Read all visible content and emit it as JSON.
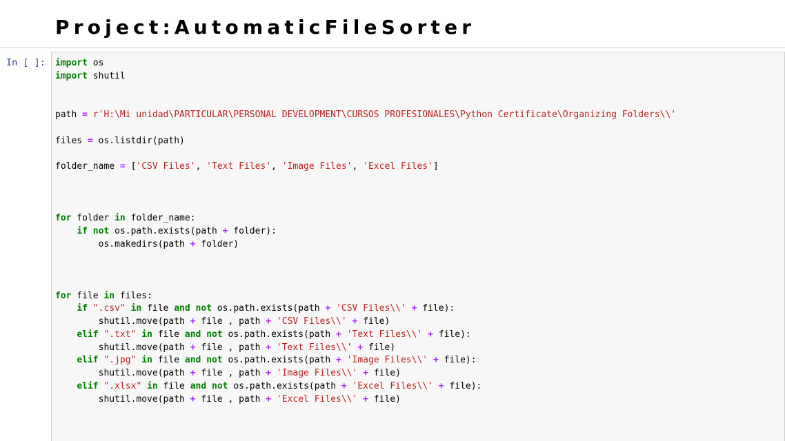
{
  "markdown_cell": {
    "title": "Project:AutomaticFileSorter"
  },
  "code_cell": {
    "prompt": "In [ ]:",
    "lines": [
      [
        [
          "kw",
          "import"
        ],
        [
          "txt",
          " os"
        ]
      ],
      [
        [
          "kw",
          "import"
        ],
        [
          "txt",
          " shutil"
        ]
      ],
      [],
      [],
      [
        [
          "txt",
          "path "
        ],
        [
          "op",
          "="
        ],
        [
          "txt",
          " "
        ],
        [
          "str",
          "r'H:\\Mi unidad\\PARTICULAR\\PERSONAL DEVELOPMENT\\CURSOS PROFESIONALES\\Python Certificate\\Organizing Folders\\\\'"
        ]
      ],
      [],
      [
        [
          "txt",
          "files "
        ],
        [
          "op",
          "="
        ],
        [
          "txt",
          " os.listdir(path)"
        ]
      ],
      [],
      [
        [
          "txt",
          "folder_name "
        ],
        [
          "op",
          "="
        ],
        [
          "txt",
          " ["
        ],
        [
          "str",
          "'CSV Files'"
        ],
        [
          "txt",
          ", "
        ],
        [
          "str",
          "'Text Files'"
        ],
        [
          "txt",
          ", "
        ],
        [
          "str",
          "'Image Files'"
        ],
        [
          "txt",
          ", "
        ],
        [
          "str",
          "'Excel Files'"
        ],
        [
          "txt",
          "]"
        ]
      ],
      [],
      [],
      [],
      [
        [
          "kw",
          "for"
        ],
        [
          "txt",
          " folder "
        ],
        [
          "kw",
          "in"
        ],
        [
          "txt",
          " folder_name:"
        ]
      ],
      [
        [
          "txt",
          "    "
        ],
        [
          "kw",
          "if"
        ],
        [
          "txt",
          " "
        ],
        [
          "kw",
          "not"
        ],
        [
          "txt",
          " os.path.exists(path "
        ],
        [
          "op",
          "+"
        ],
        [
          "txt",
          " folder):"
        ]
      ],
      [
        [
          "txt",
          "        os.makedirs(path "
        ],
        [
          "op",
          "+"
        ],
        [
          "txt",
          " folder)"
        ]
      ],
      [],
      [],
      [],
      [
        [
          "kw",
          "for"
        ],
        [
          "txt",
          " file "
        ],
        [
          "kw",
          "in"
        ],
        [
          "txt",
          " files:"
        ]
      ],
      [
        [
          "txt",
          "    "
        ],
        [
          "kw",
          "if"
        ],
        [
          "txt",
          " "
        ],
        [
          "str",
          "\".csv\""
        ],
        [
          "txt",
          " "
        ],
        [
          "kw",
          "in"
        ],
        [
          "txt",
          " file "
        ],
        [
          "kw",
          "and"
        ],
        [
          "txt",
          " "
        ],
        [
          "kw",
          "not"
        ],
        [
          "txt",
          " os.path.exists(path "
        ],
        [
          "op",
          "+"
        ],
        [
          "txt",
          " "
        ],
        [
          "str",
          "'CSV Files\\\\'"
        ],
        [
          "txt",
          " "
        ],
        [
          "op",
          "+"
        ],
        [
          "txt",
          " file):"
        ]
      ],
      [
        [
          "txt",
          "        shutil.move(path "
        ],
        [
          "op",
          "+"
        ],
        [
          "txt",
          " file , path "
        ],
        [
          "op",
          "+"
        ],
        [
          "txt",
          " "
        ],
        [
          "str",
          "'CSV Files\\\\'"
        ],
        [
          "txt",
          " "
        ],
        [
          "op",
          "+"
        ],
        [
          "txt",
          " file)"
        ]
      ],
      [
        [
          "txt",
          "    "
        ],
        [
          "kw",
          "elif"
        ],
        [
          "txt",
          " "
        ],
        [
          "str",
          "\".txt\""
        ],
        [
          "txt",
          " "
        ],
        [
          "kw",
          "in"
        ],
        [
          "txt",
          " file "
        ],
        [
          "kw",
          "and"
        ],
        [
          "txt",
          " "
        ],
        [
          "kw",
          "not"
        ],
        [
          "txt",
          " os.path.exists(path "
        ],
        [
          "op",
          "+"
        ],
        [
          "txt",
          " "
        ],
        [
          "str",
          "'Text Files\\\\'"
        ],
        [
          "txt",
          " "
        ],
        [
          "op",
          "+"
        ],
        [
          "txt",
          " file):"
        ]
      ],
      [
        [
          "txt",
          "        shutil.move(path "
        ],
        [
          "op",
          "+"
        ],
        [
          "txt",
          " file , path "
        ],
        [
          "op",
          "+"
        ],
        [
          "txt",
          " "
        ],
        [
          "str",
          "'Text Files\\\\'"
        ],
        [
          "txt",
          " "
        ],
        [
          "op",
          "+"
        ],
        [
          "txt",
          " file)"
        ]
      ],
      [
        [
          "txt",
          "    "
        ],
        [
          "kw",
          "elif"
        ],
        [
          "txt",
          " "
        ],
        [
          "str",
          "\".jpg\""
        ],
        [
          "txt",
          " "
        ],
        [
          "kw",
          "in"
        ],
        [
          "txt",
          " file "
        ],
        [
          "kw",
          "and"
        ],
        [
          "txt",
          " "
        ],
        [
          "kw",
          "not"
        ],
        [
          "txt",
          " os.path.exists(path "
        ],
        [
          "op",
          "+"
        ],
        [
          "txt",
          " "
        ],
        [
          "str",
          "'Image Files\\\\'"
        ],
        [
          "txt",
          " "
        ],
        [
          "op",
          "+"
        ],
        [
          "txt",
          " file):"
        ]
      ],
      [
        [
          "txt",
          "        shutil.move(path "
        ],
        [
          "op",
          "+"
        ],
        [
          "txt",
          " file , path "
        ],
        [
          "op",
          "+"
        ],
        [
          "txt",
          " "
        ],
        [
          "str",
          "'Image Files\\\\'"
        ],
        [
          "txt",
          " "
        ],
        [
          "op",
          "+"
        ],
        [
          "txt",
          " file)"
        ]
      ],
      [
        [
          "txt",
          "    "
        ],
        [
          "kw",
          "elif"
        ],
        [
          "txt",
          " "
        ],
        [
          "str",
          "\".xlsx\""
        ],
        [
          "txt",
          " "
        ],
        [
          "kw",
          "in"
        ],
        [
          "txt",
          " file "
        ],
        [
          "kw",
          "and"
        ],
        [
          "txt",
          " "
        ],
        [
          "kw",
          "not"
        ],
        [
          "txt",
          " os.path.exists(path "
        ],
        [
          "op",
          "+"
        ],
        [
          "txt",
          " "
        ],
        [
          "str",
          "'Excel Files\\\\'"
        ],
        [
          "txt",
          " "
        ],
        [
          "op",
          "+"
        ],
        [
          "txt",
          " file):"
        ]
      ],
      [
        [
          "txt",
          "        shutil.move(path "
        ],
        [
          "op",
          "+"
        ],
        [
          "txt",
          " file , path "
        ],
        [
          "op",
          "+"
        ],
        [
          "txt",
          " "
        ],
        [
          "str",
          "'Excel Files\\\\'"
        ],
        [
          "txt",
          " "
        ],
        [
          "op",
          "+"
        ],
        [
          "txt",
          " file)"
        ]
      ]
    ]
  }
}
